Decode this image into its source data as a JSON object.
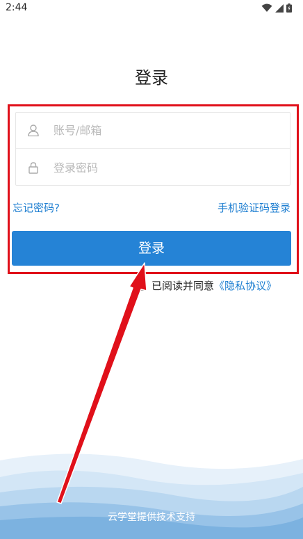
{
  "status_bar": {
    "time": "2:44",
    "icons": [
      "wifi-icon",
      "signal-icon",
      "battery-icon"
    ]
  },
  "page": {
    "title": "登录"
  },
  "form": {
    "account_placeholder": "账号/邮箱",
    "password_placeholder": "登录密码",
    "account_icon": "user-icon",
    "password_icon": "lock-icon"
  },
  "links": {
    "forgot_password": "忘记密码?",
    "sms_login": "手机验证码登录"
  },
  "login_button": {
    "label": "登录"
  },
  "agreement": {
    "text": "已阅读并同意",
    "link": "《隐私协议》",
    "checked": false
  },
  "footer": {
    "text": "云学堂提供技术支持"
  },
  "colors": {
    "accent": "#2583d6",
    "link": "#1f7fd1",
    "annotation": "#e0101a"
  }
}
